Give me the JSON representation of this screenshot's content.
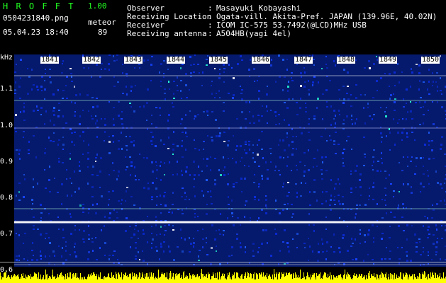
{
  "app": {
    "title": "H R O F F T",
    "version": "1.00",
    "filename": "0504231840.png",
    "mode": "meteor",
    "datetime": "05.04.23 18:40",
    "count": "89"
  },
  "info": {
    "labels": [
      "Observer",
      "Receiving Location",
      "Receiver",
      "Receiving antenna"
    ],
    "separator": ":",
    "values": [
      "Masayuki Kobayashi",
      "Ogata-vill. Akita-Pref. JAPAN (139.96E, 40.02N)",
      "ICOM IC-575 53.7492(@LCD)MHz USB",
      "A504HB(yagi 4el)"
    ]
  },
  "axes": {
    "y_unit": "kHz",
    "y_ticks": [
      "1.1",
      "1.0",
      "0.9",
      "0.8",
      "0.7",
      "0.6"
    ],
    "x_ticks": [
      "1841",
      "1842",
      "1843",
      "1844",
      "1845",
      "1846",
      "1847",
      "1848",
      "1849",
      "1850"
    ]
  },
  "spectrogram": {
    "horizontal_lines": [
      {
        "freq_khz": 1.14,
        "color": "#ffffff"
      },
      {
        "freq_khz": 1.07,
        "color": "#b7ffd5"
      },
      {
        "freq_khz": 0.995,
        "color": "#c9c9ff"
      },
      {
        "freq_khz": 0.77,
        "color": "#b7ffd5"
      },
      {
        "freq_khz": 0.734,
        "color": "#ffffff"
      },
      {
        "freq_khz": 0.615,
        "color": "#d9d9d9"
      }
    ],
    "background_color": "#061a6d",
    "noise_colors": [
      "#0a2bd9",
      "#1743ff",
      "#1d5dff",
      "#25ffd7",
      "#ffffff"
    ],
    "amplitude_color": "#ffff00"
  }
}
